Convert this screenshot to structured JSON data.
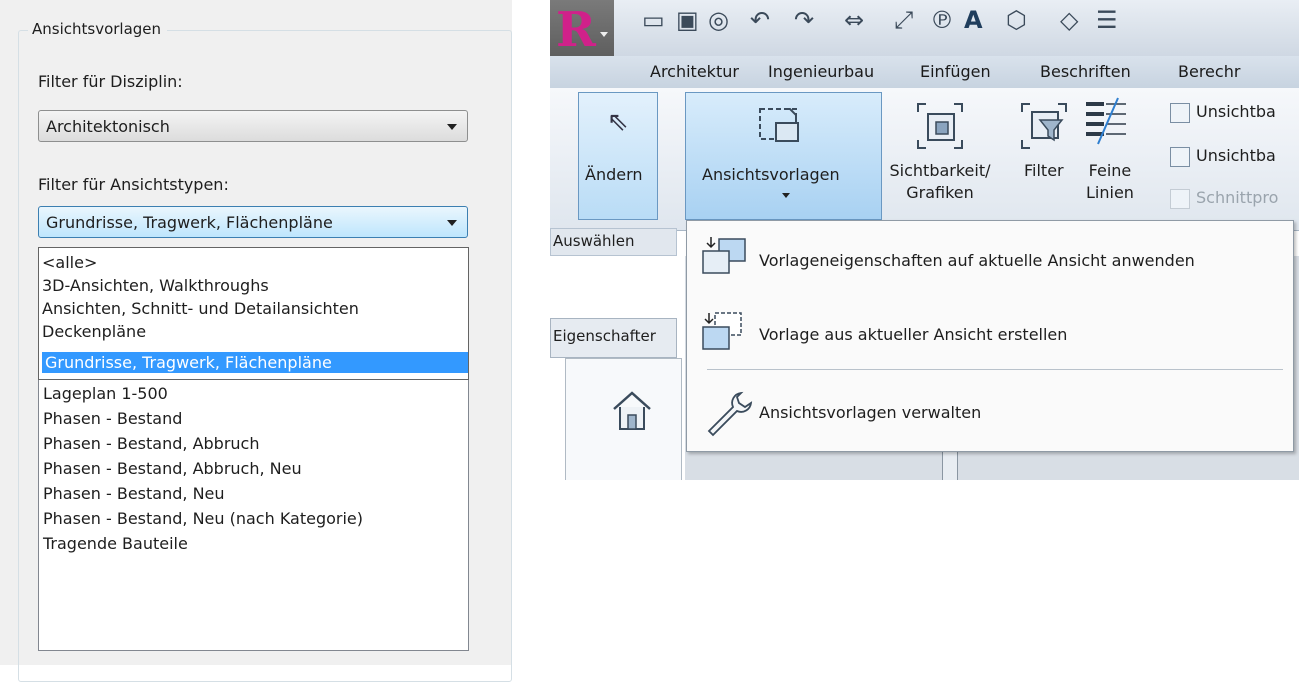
{
  "left_dialog": {
    "group_title": "Ansichtsvorlagen",
    "discipline_label": "Filter für Disziplin:",
    "discipline_value": "Architektonisch",
    "viewtype_label": "Filter für Ansichtstypen:",
    "viewtype_value": "Grundrisse, Tragwerk, Flächenpläne",
    "dropdown_options": [
      "<alle>",
      "3D-Ansichten, Walkthroughs",
      "Ansichten, Schnitt- und Detailansichten",
      "Deckenpläne",
      "Grundrisse, Tragwerk, Flächenpläne"
    ],
    "selected_option": "Grundrisse, Tragwerk, Flächenpläne",
    "templates": [
      "Lageplan 1-500",
      "Phasen - Bestand",
      "Phasen - Bestand, Abbruch",
      "Phasen - Bestand, Abbruch, Neu",
      "Phasen - Bestand, Neu",
      "Phasen - Bestand, Neu (nach Kategorie)",
      "Tragende Bauteile"
    ]
  },
  "ribbon": {
    "tabs": [
      "Architektur",
      "Ingenieurbau",
      "Einfügen",
      "Beschriften",
      "Berechr"
    ],
    "modify_label": "Ändern",
    "select_group": "Auswählen",
    "view_templates_label": "Ansichtsvorlagen",
    "visibility_label_1": "Sichtbarkeit/",
    "visibility_label_2": "Grafiken",
    "filter_label": "Filter",
    "thin_lines_1": "Feine",
    "thin_lines_2": "Linien",
    "hidden_1": "Unsichtba",
    "hidden_2": "Unsichtba",
    "section_profile": "Schnittpro",
    "properties_label": "Eigenschafter",
    "app_letter": "R",
    "app_sub": "A",
    "text_tool": "A"
  },
  "menu": {
    "items": [
      "Vorlageneigenschaften auf aktuelle Ansicht anwenden",
      "Vorlage aus aktueller Ansicht erstellen",
      "Ansichtsvorlagen verwalten"
    ]
  },
  "colors": {
    "selection": "#3399ff",
    "ribbon_active": "#b9dcf6",
    "app_logo": "#d0218a"
  }
}
